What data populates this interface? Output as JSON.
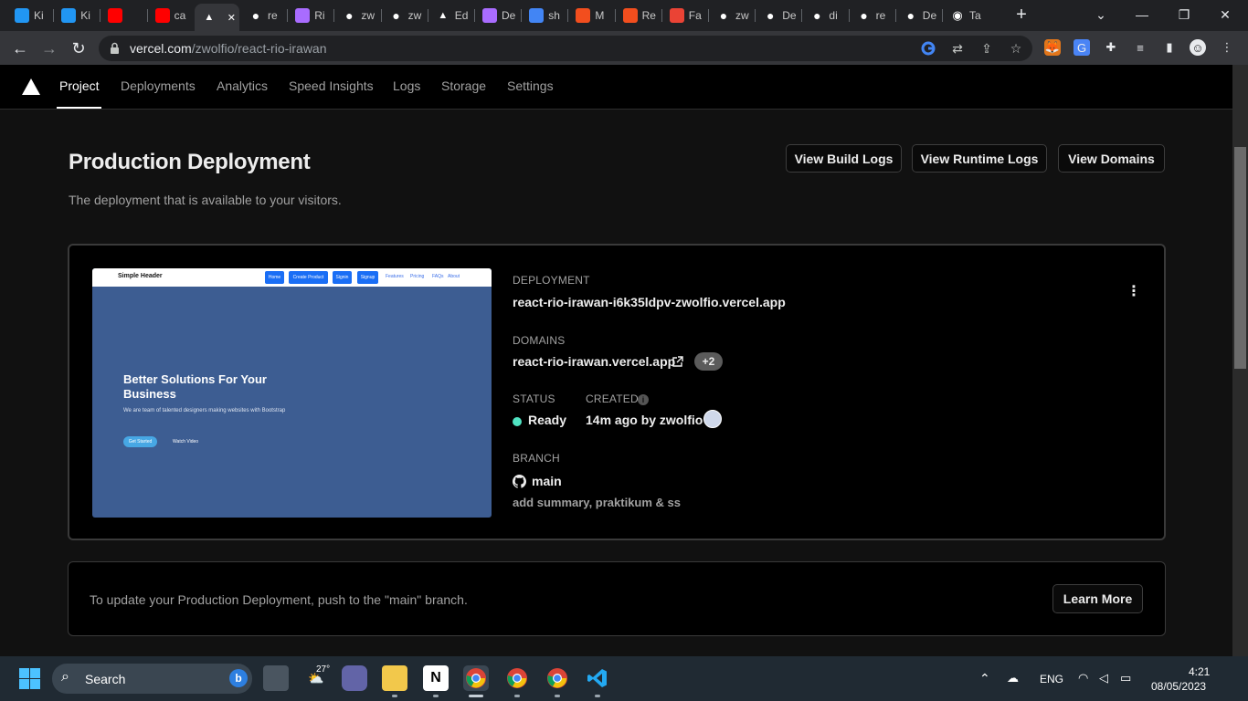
{
  "browser": {
    "tabs": [
      {
        "title": "Ki",
        "icon": "kinsta-icon",
        "color": "#2196f3"
      },
      {
        "title": "Ki",
        "icon": "kinsta-icon",
        "color": "#2196f3"
      },
      {
        "title": "",
        "icon": "youtube-icon",
        "color": "#ff0000"
      },
      {
        "title": "ca",
        "icon": "youtube-icon",
        "color": "#ff0000"
      },
      {
        "title": "",
        "icon": "vercel-icon",
        "color": "#ffffff",
        "active": true
      },
      {
        "title": "re",
        "icon": "github-icon",
        "color": "#ffffff"
      },
      {
        "title": "Ri",
        "icon": "vite-icon",
        "color": "#a96cff"
      },
      {
        "title": "zw",
        "icon": "github-icon",
        "color": "#ffffff"
      },
      {
        "title": "zw",
        "icon": "github-icon",
        "color": "#ffffff"
      },
      {
        "title": "Ed",
        "icon": "vercel-icon",
        "color": "#ffffff"
      },
      {
        "title": "De",
        "icon": "vite-icon",
        "color": "#a96cff"
      },
      {
        "title": "sh",
        "icon": "google-icon",
        "color": "#4285f4"
      },
      {
        "title": "M",
        "icon": "figma-icon",
        "color": "#f24e1e"
      },
      {
        "title": "Re",
        "icon": "figma-icon",
        "color": "#f24e1e"
      },
      {
        "title": "Fa",
        "icon": "gmail-icon",
        "color": "#ea4335"
      },
      {
        "title": "zw",
        "icon": "github-icon",
        "color": "#ffffff"
      },
      {
        "title": "De",
        "icon": "github-icon",
        "color": "#ffffff"
      },
      {
        "title": "di",
        "icon": "github-icon",
        "color": "#ffffff"
      },
      {
        "title": "re",
        "icon": "github-icon",
        "color": "#ffffff"
      },
      {
        "title": "De",
        "icon": "github-icon",
        "color": "#ffffff"
      },
      {
        "title": "Ta",
        "icon": "chrome-icon",
        "color": "#ffffff"
      }
    ],
    "new_tab_label": "+",
    "url_host": "vercel.com",
    "url_path": "/zwolfio/react-rio-irawan"
  },
  "vercel_nav": {
    "tabs": [
      "Project",
      "Deployments",
      "Analytics",
      "Speed Insights",
      "Logs",
      "Storage",
      "Settings"
    ],
    "active_tab": "Project"
  },
  "production": {
    "title": "Production Deployment",
    "subtitle": "The deployment that is available to your visitors.",
    "buttons": {
      "build_logs": "View Build Logs",
      "runtime_logs": "View Runtime Logs",
      "domains": "View Domains"
    }
  },
  "preview": {
    "brand": "Simple Header",
    "nav_buttons": [
      "Home",
      "Create Product",
      "Signin",
      "Signup"
    ],
    "nav_links": [
      "Features",
      "Pricing",
      "FAQs",
      "About"
    ],
    "hero_title": "Better Solutions For Your Business",
    "hero_desc": "We are team of talented designers making websites with Bootstrap",
    "cta": "Get Started",
    "video_link": "Watch Video"
  },
  "deployment": {
    "deployment_label": "DEPLOYMENT",
    "deployment_url": "react-rio-irawan-i6k35ldpv-zwolfio.vercel.app",
    "domains_label": "DOMAINS",
    "domain": "react-rio-irawan.vercel.app",
    "extra_domains": "+2",
    "status_label": "STATUS",
    "status": "Ready",
    "status_color": "#50e3c2",
    "created_label": "CREATED",
    "created": "14m ago by zwolfio",
    "branch_label": "BRANCH",
    "branch": "main",
    "commit_message": "add summary, praktikum & ss"
  },
  "notice": {
    "text": "To update your Production Deployment, push to the \"main\" branch.",
    "button": "Learn More"
  },
  "taskbar": {
    "search_placeholder": "Search",
    "weather": "27°",
    "language": "ENG",
    "time": "4:21",
    "date": "08/05/2023"
  }
}
